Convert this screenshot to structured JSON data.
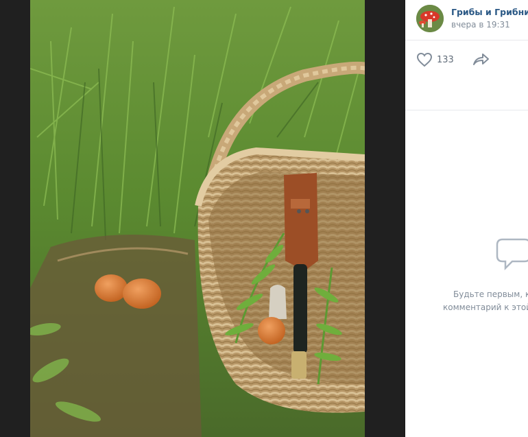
{
  "post": {
    "author": "Грибы и Грибники",
    "time": "вчера в 19:31",
    "likes": "133"
  },
  "comments": {
    "empty_line1": "Будьте первым, к",
    "empty_line2": "комментарий к этой"
  },
  "icons": {
    "like": "heart-icon",
    "share": "share-icon",
    "comments": "comment-bubble-icon"
  },
  "colors": {
    "link": "#2a5885",
    "secondary": "#818c99",
    "viewer_bg": "#202020"
  }
}
